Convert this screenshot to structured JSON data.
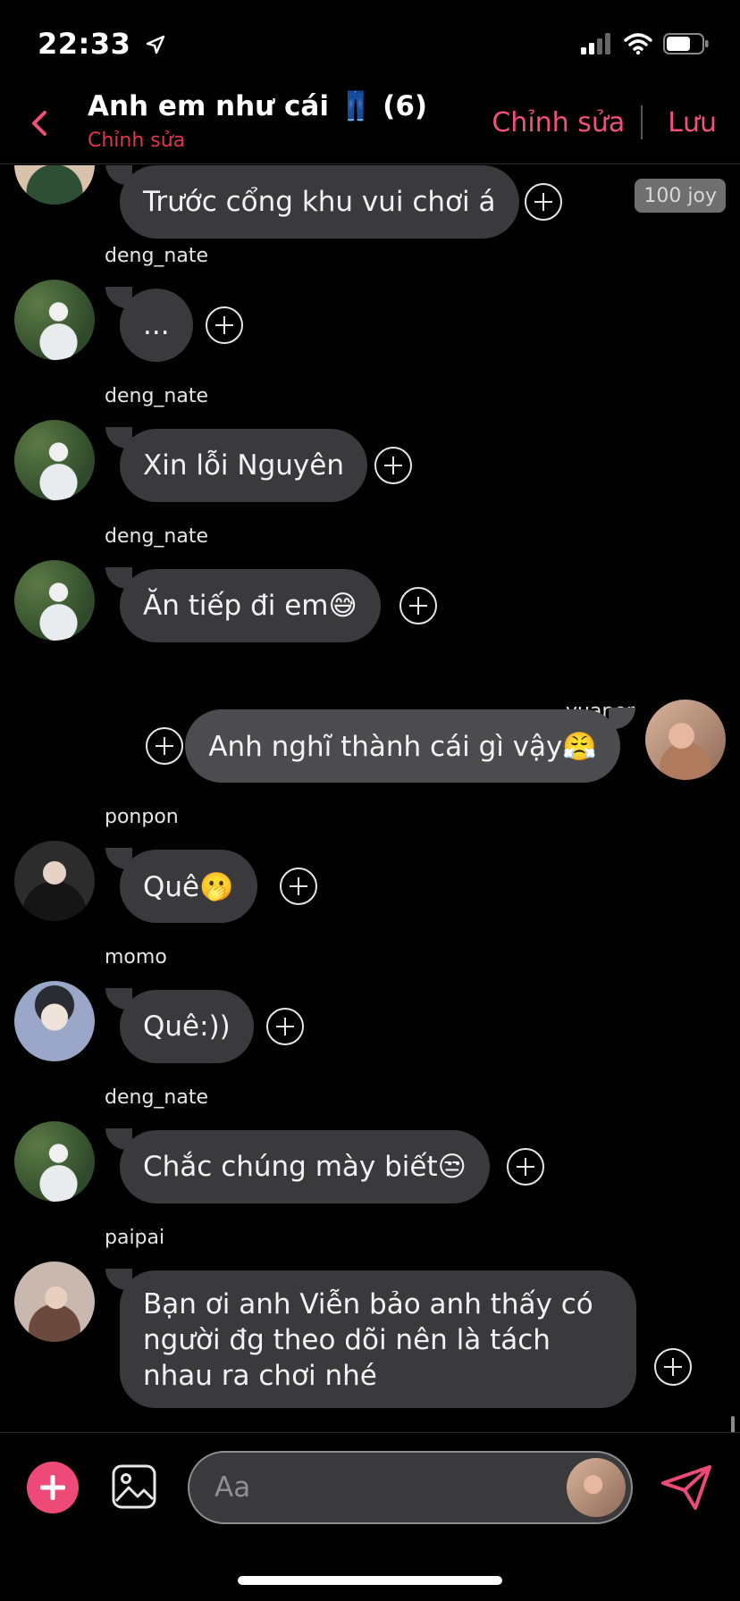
{
  "status": {
    "time": "22:33"
  },
  "header": {
    "title": "Anh em như cái 👖 (6)",
    "subtitle": "Chỉnh sửa",
    "edit_label": "Chỉnh sửa",
    "save_label": "Lưu"
  },
  "messages": [
    {
      "sender": "",
      "text": "Trước cổng khu vui chơi á",
      "badge": "100 joy"
    },
    {
      "sender": "deng_nate",
      "text": "..."
    },
    {
      "sender": "deng_nate",
      "text": "Xin lỗi Nguyên"
    },
    {
      "sender": "deng_nate",
      "text": "Ăn tiếp đi em😅"
    },
    {
      "sender": "yuaner",
      "text": "Anh nghĩ thành cái gì vậy😤"
    },
    {
      "sender": "ponpon",
      "text": "Quê🫢"
    },
    {
      "sender": "momo",
      "text": "Quê:))"
    },
    {
      "sender": "deng_nate",
      "text": "Chắc chúng mày biết😒"
    },
    {
      "sender": "paipai",
      "text": "Bạn ơi anh Viễn bảo anh thấy có người đg theo dõi nên là tách nhau ra chơi nhé"
    }
  ],
  "composer": {
    "placeholder": "Aa"
  },
  "colors": {
    "accent": "#ed4a78",
    "link": "#f0507a",
    "subtitle": "#e0364d",
    "bubble": "#3a3a3c"
  }
}
